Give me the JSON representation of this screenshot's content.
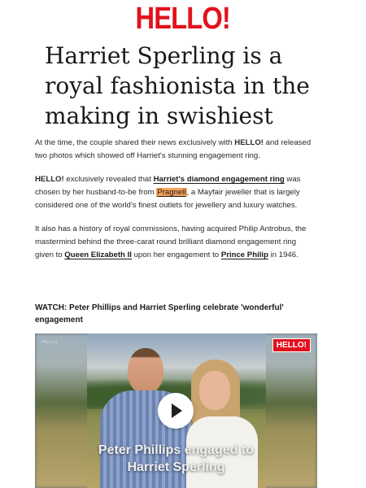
{
  "brand": {
    "logo_text": "HELLO!",
    "accent_color": "#e3111d"
  },
  "headline": "Harriet Sperling is a royal fashionista in the making in swishiest",
  "article": {
    "p1_a": "At the time, the couple shared their news exclusively with ",
    "p1_brand": "HELLO!",
    "p1_b": " and released two photos which showed off Harriet's stunning engagement ring.",
    "p2_brand": "HELLO!",
    "p2_a": " exclusively revealed that ",
    "p2_link1": "Harriet's diamond engagement ring",
    "p2_b": " was chosen by her husband-to-be from ",
    "p2_link2": "Pragnell",
    "p2_c": ", a Mayfair jeweller that is largely considered one of the world's finest outlets for jewellery and luxury watches.",
    "p3_a": "It also has a history of royal commissions, having acquired Philip Antrobus, the mastermind behind the three-carat round brilliant diamond engagement ring given to ",
    "p3_link1": "Queen Elizabeth II",
    "p3_b": " upon her engagement to ",
    "p3_link2": "Prince Philip",
    "p3_c": " in 1946."
  },
  "watch": "WATCH: Peter Phillips and Harriet Sperling celebrate 'wonderful' engagement",
  "video": {
    "badge": "HELLO!",
    "corner_tag": "HELLO",
    "caption_line1": "Peter Phillips engaged to",
    "caption_line2": "Harriet Sperling",
    "play_icon": "play-icon"
  }
}
